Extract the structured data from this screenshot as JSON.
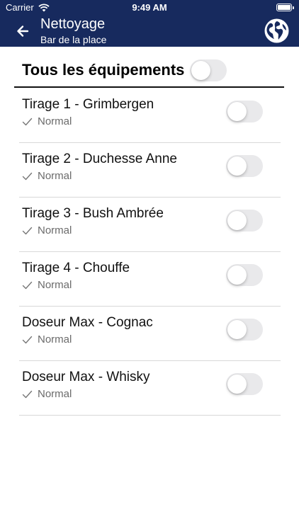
{
  "status_bar": {
    "carrier": "Carrier",
    "time": "9:49 AM",
    "wifi_icon": "wifi-icon",
    "battery_icon": "battery-icon"
  },
  "header": {
    "title": "Nettoyage",
    "subtitle": "Bar de la place",
    "back_icon": "arrow-left-icon",
    "globe_icon": "globe-icon",
    "background_color": "#172a5e"
  },
  "all_equipment": {
    "label": "Tous les équipements",
    "toggle_on": false
  },
  "equipment": [
    {
      "name": "Tirage 1 - Grimbergen",
      "status": "Normal",
      "toggle_on": false
    },
    {
      "name": "Tirage 2 - Duchesse Anne",
      "status": "Normal",
      "toggle_on": false
    },
    {
      "name": "Tirage 3 - Bush Ambrée",
      "status": "Normal",
      "toggle_on": false
    },
    {
      "name": "Tirage 4 - Chouffe",
      "status": "Normal",
      "toggle_on": false
    },
    {
      "name": "Doseur Max - Cognac",
      "status": "Normal",
      "toggle_on": false
    },
    {
      "name": "Doseur Max - Whisky",
      "status": "Normal",
      "toggle_on": false
    }
  ]
}
